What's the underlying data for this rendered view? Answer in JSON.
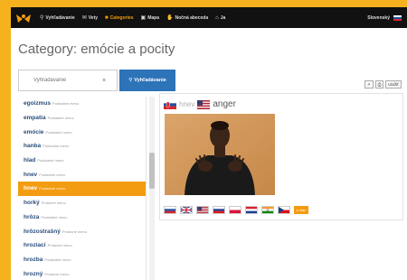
{
  "nav": {
    "items": [
      {
        "label": "Vyhľadávanie",
        "icon": "search-icon",
        "glyph": "⚲"
      },
      {
        "label": "Vety",
        "icon": "chat-icon",
        "glyph": "✉"
      },
      {
        "label": "Categories",
        "icon": "folder-icon",
        "glyph": "■",
        "active": true
      },
      {
        "label": "Mapa",
        "icon": "map-icon",
        "glyph": "▣"
      },
      {
        "label": "Nočná abeceda",
        "icon": "hand-icon",
        "glyph": "✋"
      },
      {
        "label": "Ja",
        "icon": "home-icon",
        "glyph": "⌂"
      }
    ],
    "language_label": "Slovenský"
  },
  "page_title": "Category: emócie a pocity",
  "search": {
    "placeholder": "Vyhľadávanie",
    "clear": "×",
    "button_label": "Vyhľadávanie",
    "button_icon": "⚲"
  },
  "words": [
    {
      "word": "egoizmus",
      "pos": "Podstatné meno"
    },
    {
      "word": "empatia",
      "pos": "Podstatné meno"
    },
    {
      "word": "emócie",
      "pos": "Podstatné meno"
    },
    {
      "word": "hanba",
      "pos": "Podstatné meno"
    },
    {
      "word": "hlad",
      "pos": "Podstatné meno"
    },
    {
      "word": "hnev",
      "pos": "Podstatné meno"
    },
    {
      "word": "hnev",
      "pos": "Podstatné meno",
      "selected": true
    },
    {
      "word": "horký",
      "pos": "Prídavné meno"
    },
    {
      "word": "hrôza",
      "pos": "Podstatné meno"
    },
    {
      "word": "hrôzostrašný",
      "pos": "Prídavné meno"
    },
    {
      "word": "hroziaci",
      "pos": "Prídavné meno"
    },
    {
      "word": "hrozba",
      "pos": "Podstatné meno"
    },
    {
      "word": "hrozný",
      "pos": "Prídavné meno"
    }
  ],
  "detail": {
    "word_sk": "hnev",
    "word_en": "anger"
  },
  "toolbar": {
    "share": "↗",
    "print": "⎙",
    "save": "Uložiť"
  },
  "flags": [
    "slovak",
    "uk",
    "usa",
    "russia",
    "poland",
    "croatia",
    "india",
    "czech"
  ],
  "more_label": "▸ viac",
  "colors": {
    "accent": "#f39c12",
    "primary": "#2d73b8",
    "link": "#2a4d7a",
    "frame": "#f6b21e"
  }
}
